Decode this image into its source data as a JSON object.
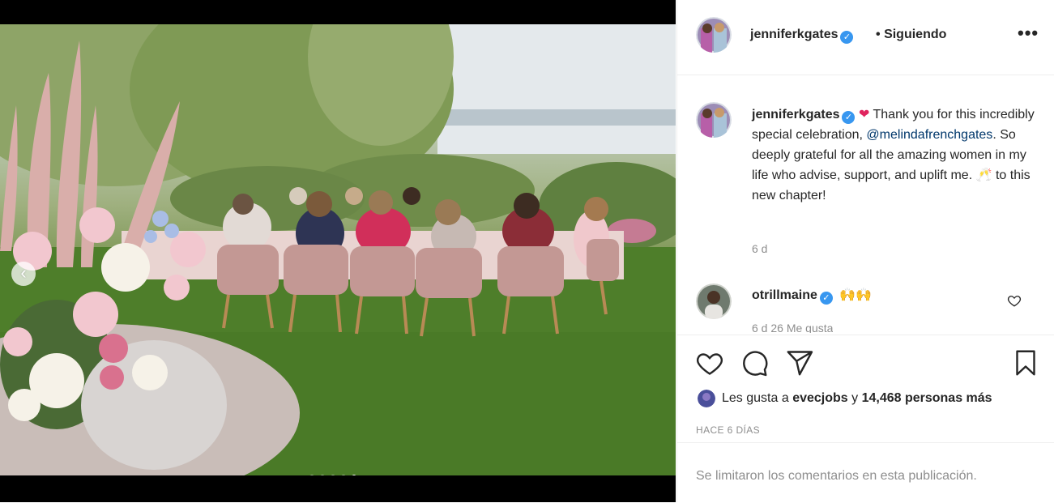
{
  "post": {
    "username": "jenniferkgates",
    "follow_separator": "•",
    "follow_label": "Siguiendo",
    "more_label": "•••"
  },
  "caption": {
    "username": "jenniferkgates",
    "heart": "❤",
    "text_before_mention": " Thank you for this incredibly special celebration, ",
    "mention": "@melindafrenchgates",
    "text_after_mention": ". So deeply grateful for all the amazing women in my life who advise, support, and uplift me. 🥂 to this new chapter!",
    "time": "6 d"
  },
  "comment": {
    "username": "otrillmaine",
    "text": "🙌🙌",
    "meta": "6 d   26 Me gusta"
  },
  "likes": {
    "prefix": "Les gusta a",
    "user": "evecjobs",
    "middle": "y",
    "count": "14,468 personas más"
  },
  "timestamp": "HACE 6 DÍAS",
  "footer_text": "Se limitaron los comentarios en esta publicación.",
  "carousel": {
    "total": 5,
    "active_index": 4
  },
  "colors": {
    "verified": "#3897f0",
    "mention": "#00376b",
    "muted": "#8e8e8e"
  },
  "icons": [
    "chevron-left-icon",
    "verified-badge-icon",
    "more-icon",
    "heart-icon",
    "comment-icon",
    "share-icon",
    "bookmark-icon"
  ]
}
